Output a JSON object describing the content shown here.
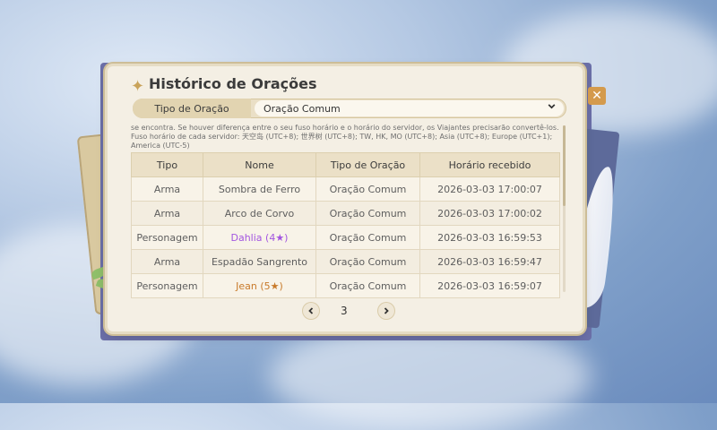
{
  "window": {
    "title": "Histórico de Orações",
    "title_icon": "sparkle-icon",
    "close_icon": "close-icon"
  },
  "filter": {
    "label": "Tipo de Oração",
    "value": "Oração Comum",
    "icon": "chevron-down-icon"
  },
  "notice": "se encontra. Se houver diferença entre o seu fuso horário e o horário do servidor, os Viajantes precisarão convertê-los. Fuso horário de cada servidor: 天空岛 (UTC+8); 世界树 (UTC+8); TW, HK, MO (UTC+8); Asia (UTC+8); Europe (UTC+1); America (UTC-5)",
  "table": {
    "headers": [
      "Tipo",
      "Nome",
      "Tipo de Oração",
      "Horário recebido"
    ],
    "rows": [
      {
        "tipo": "Arma",
        "nome": "Sombra de Ferro",
        "oracao": "Oração Comum",
        "horario": "2026-03-03 17:00:07"
      },
      {
        "tipo": "Arma",
        "nome": "Arco de Corvo",
        "oracao": "Oração Comum",
        "horario": "2026-03-03 17:00:02"
      },
      {
        "tipo": "Personagem",
        "nome": "Dahlia (4★)",
        "oracao": "Oração Comum",
        "horario": "2026-03-03 16:59:53"
      },
      {
        "tipo": "Arma",
        "nome": "Espadão Sangrento",
        "oracao": "Oração Comum",
        "horario": "2026-03-03 16:59:47"
      },
      {
        "tipo": "Personagem",
        "nome": "Jean (5★)",
        "oracao": "Oração Comum",
        "horario": "2026-03-03 16:59:07"
      }
    ]
  },
  "colors": {
    "rarity_4": "#a356e0",
    "rarity_5": "#c87a2a",
    "accent": "#d49a4c"
  },
  "pagination": {
    "page": "3",
    "prev_icon": "chevron-left-icon",
    "next_icon": "chevron-right-icon"
  }
}
